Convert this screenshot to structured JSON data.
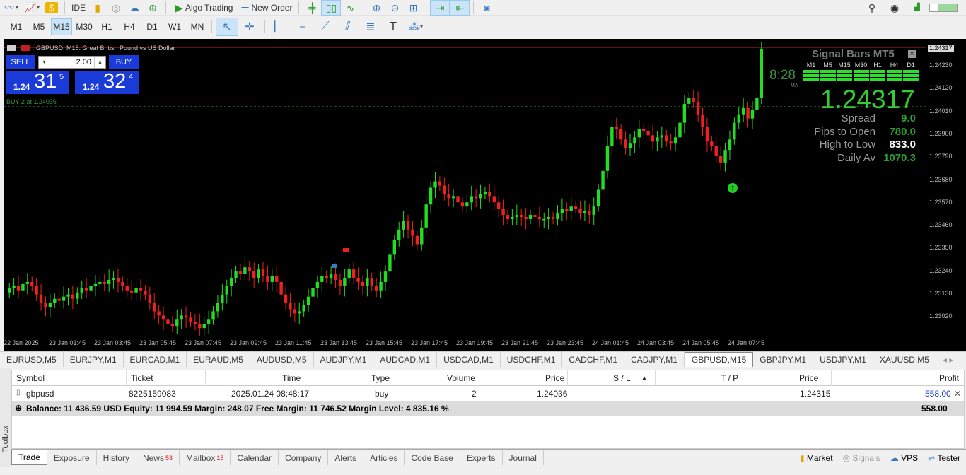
{
  "toolbar": {
    "ide_label": "IDE",
    "algo_label": "Algo Trading",
    "new_order_label": "New Order"
  },
  "timeframes": [
    "M1",
    "M5",
    "M15",
    "M30",
    "H1",
    "H4",
    "D1",
    "W1",
    "MN"
  ],
  "active_timeframe": "M15",
  "chart": {
    "title": "GBPUSD, M15:  Great British Pound vs US Dollar",
    "sell_label": "SELL",
    "buy_label": "BUY",
    "volume": "2.00",
    "sell_small": "1.24",
    "sell_big": "31",
    "sell_sup": "5",
    "buy_small": "1.24",
    "buy_big": "32",
    "buy_sup": "4",
    "position_line_label": "BUY 2 at 1.24036",
    "current_price_tag": "1.24317"
  },
  "signal_panel": {
    "title": "Signal Bars MT5",
    "close": "×",
    "timeframes": [
      "M1",
      "M5",
      "M15",
      "M30",
      "H1",
      "H4",
      "D1"
    ],
    "time": "8:28",
    "ma_label": "MA",
    "price": "1.24317",
    "rows": [
      {
        "label": "Spread",
        "value": "9.0",
        "color": "#2e9a2e"
      },
      {
        "label": "Pips to Open",
        "value": "780.0",
        "color": "#2e9a2e"
      },
      {
        "label": "High to Low",
        "value": "833.0",
        "color": "#ffffff"
      },
      {
        "label": "Daily Av",
        "value": "1070.3",
        "color": "#2e9a2e"
      }
    ]
  },
  "price_axis": [
    "1.24317",
    "1.24230",
    "1.24120",
    "1.24010",
    "1.23900",
    "1.23790",
    "1.23680",
    "1.23570",
    "1.23460",
    "1.23350",
    "1.23240",
    "1.23130",
    "1.23020"
  ],
  "time_axis": [
    "22 Jan 2025",
    "23 Jan 01:45",
    "23 Jan 03:45",
    "23 Jan 05:45",
    "23 Jan 07:45",
    "23 Jan 09:45",
    "23 Jan 11:45",
    "23 Jan 13:45",
    "23 Jan 15:45",
    "23 Jan 17:45",
    "23 Jan 19:45",
    "23 Jan 21:45",
    "23 Jan 23:45",
    "24 Jan 01:45",
    "24 Jan 03:45",
    "24 Jan 05:45",
    "24 Jan 07:45"
  ],
  "symbol_tabs": [
    "EURUSD,M5",
    "EURJPY,M1",
    "EURCAD,M1",
    "EURAUD,M5",
    "AUDUSD,M5",
    "AUDJPY,M1",
    "AUDCAD,M1",
    "USDCAD,M1",
    "USDCHF,M1",
    "CADCHF,M1",
    "CADJPY,M1",
    "GBPUSD,M15",
    "GBPJPY,M1",
    "USDJPY,M1",
    "XAUUSD,M5"
  ],
  "active_symbol_tab": "GBPUSD,M15",
  "trade_grid": {
    "headers": {
      "symbol": "Symbol",
      "ticket": "Ticket",
      "time": "Time",
      "type": "Type",
      "volume": "Volume",
      "price": "Price",
      "sl": "S / L",
      "tp": "T / P",
      "price2": "Price",
      "profit": "Profit"
    },
    "row": {
      "symbol": "gbpusd",
      "ticket": "8225159083",
      "time": "2025.01.24 08:48:17",
      "type": "buy",
      "volume": "2",
      "price": "1.24036",
      "price2": "1.24315",
      "profit": "558.00"
    },
    "summary": "Balance: 11 436.59 USD  Equity: 11 994.59  Margin: 248.07  Free Margin: 11 746.52  Margin Level: 4 835.16 %",
    "summary_profit": "558.00"
  },
  "toolbox_label": "Toolbox",
  "bottom_tabs": [
    {
      "label": "Trade",
      "badge": ""
    },
    {
      "label": "Exposure",
      "badge": ""
    },
    {
      "label": "History",
      "badge": ""
    },
    {
      "label": "News",
      "badge": "53"
    },
    {
      "label": "Mailbox",
      "badge": "15"
    },
    {
      "label": "Calendar",
      "badge": ""
    },
    {
      "label": "Company",
      "badge": ""
    },
    {
      "label": "Alerts",
      "badge": ""
    },
    {
      "label": "Articles",
      "badge": ""
    },
    {
      "label": "Code Base",
      "badge": ""
    },
    {
      "label": "Experts",
      "badge": ""
    },
    {
      "label": "Journal",
      "badge": ""
    }
  ],
  "right_buttons": {
    "market": "Market",
    "signals": "Signals",
    "vps": "VPS",
    "tester": "Tester"
  },
  "chart_data": {
    "type": "candlestick",
    "up_color": "#22dd22",
    "down_color": "#ee2020",
    "ylim": [
      1.2294,
      1.2436
    ],
    "closes": [
      1.2317,
      1.2318,
      1.2316,
      1.2319,
      1.232,
      1.2318,
      1.2314,
      1.231,
      1.2308,
      1.231,
      1.2312,
      1.2311,
      1.2313,
      1.2314,
      1.2312,
      1.2315,
      1.2317,
      1.2316,
      1.2318,
      1.2319,
      1.232,
      1.2319,
      1.2321,
      1.2322,
      1.232,
      1.2318,
      1.2316,
      1.2315,
      1.2317,
      1.2316,
      1.2314,
      1.231,
      1.2306,
      1.2304,
      1.2302,
      1.23,
      1.2299,
      1.2302,
      1.2304,
      1.2303,
      1.2301,
      1.23,
      1.2298,
      1.23,
      1.2302,
      1.2306,
      1.231,
      1.2314,
      1.2318,
      1.2322,
      1.2325,
      1.2324,
      1.2327,
      1.2325,
      1.2322,
      1.2326,
      1.2323,
      1.232,
      1.2323,
      1.232,
      1.2314,
      1.231,
      1.2307,
      1.2305,
      1.2306,
      1.2309,
      1.2313,
      1.2317,
      1.232,
      1.2323,
      1.2322,
      1.2324,
      1.2321,
      1.2318,
      1.2322,
      1.2326,
      1.2322,
      1.232,
      1.2318,
      1.2322,
      1.2318,
      1.2316,
      1.232,
      1.2325,
      1.2333,
      1.234,
      1.2345,
      1.2349,
      1.2345,
      1.2342,
      1.2338,
      1.2346,
      1.2357,
      1.2365,
      1.2368,
      1.2366,
      1.2362,
      1.236,
      1.2361,
      1.2358,
      1.2356,
      1.2358,
      1.2361,
      1.236,
      1.2362,
      1.2363,
      1.2361,
      1.2358,
      1.2355,
      1.2352,
      1.235,
      1.2351,
      1.2352,
      1.2351,
      1.235,
      1.2352,
      1.2351,
      1.235,
      1.235,
      1.2351,
      1.235,
      1.2353,
      1.2355,
      1.2354,
      1.2356,
      1.2355,
      1.2353,
      1.2354,
      1.2352,
      1.2356,
      1.2364,
      1.2373,
      1.2385,
      1.2394,
      1.2393,
      1.2388,
      1.2384,
      1.2386,
      1.2389,
      1.2393,
      1.2392,
      1.239,
      1.2387,
      1.2389,
      1.239,
      1.2387,
      1.2386,
      1.2389,
      1.2396,
      1.2405,
      1.2408,
      1.2406,
      1.24,
      1.2394,
      1.2387,
      1.2385,
      1.238,
      1.2377,
      1.2383,
      1.2388,
      1.2396,
      1.24,
      1.2403,
      1.2398,
      1.2402,
      1.2408,
      1.2431
    ]
  }
}
